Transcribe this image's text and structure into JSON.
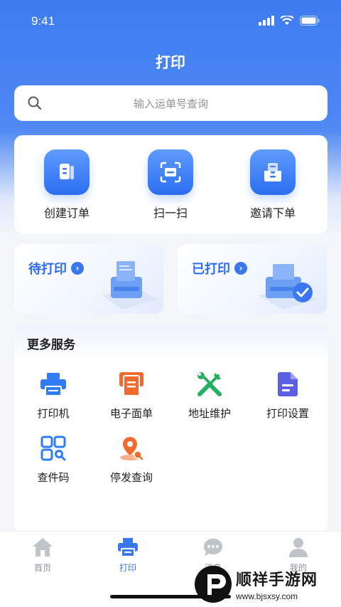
{
  "status_bar": {
    "time": "9:41"
  },
  "header": {
    "title": "打印"
  },
  "search": {
    "placeholder": "输入运单号查询"
  },
  "quick_actions": [
    {
      "label": "创建订单",
      "icon": "document-icon"
    },
    {
      "label": "扫一扫",
      "icon": "scan-icon"
    },
    {
      "label": "邀请下单",
      "icon": "inbox-icon"
    }
  ],
  "print_cards": [
    {
      "label": "待打印",
      "icon": "printer-illustration"
    },
    {
      "label": "已打印",
      "icon": "printer-done-illustration"
    }
  ],
  "more_services": {
    "title": "更多服务",
    "items": [
      {
        "label": "打印机",
        "icon": "printer-icon",
        "color": "#2f7cf6"
      },
      {
        "label": "电子面单",
        "icon": "waybill-icon",
        "color": "#f26b2e"
      },
      {
        "label": "地址维护",
        "icon": "tools-icon",
        "color": "#27ae60"
      },
      {
        "label": "打印设置",
        "icon": "file-settings-icon",
        "color": "#5b5fe0"
      },
      {
        "label": "查件码",
        "icon": "qr-search-icon",
        "color": "#2f7cf6"
      },
      {
        "label": "停发查询",
        "icon": "location-search-icon",
        "color": "#f26b2e"
      }
    ]
  },
  "tab_bar": {
    "items": [
      {
        "label": "首页",
        "icon": "home-icon"
      },
      {
        "label": "打印",
        "icon": "printer-icon",
        "active": true
      },
      {
        "label": "消息",
        "icon": "message-icon"
      },
      {
        "label": "我的",
        "icon": "user-icon"
      }
    ]
  },
  "watermark": {
    "title": "顺祥手游网",
    "url": "www.bjsxsy.com"
  },
  "colors": {
    "accent": "#3b78f0",
    "header_bg": "#3d7cf1"
  }
}
